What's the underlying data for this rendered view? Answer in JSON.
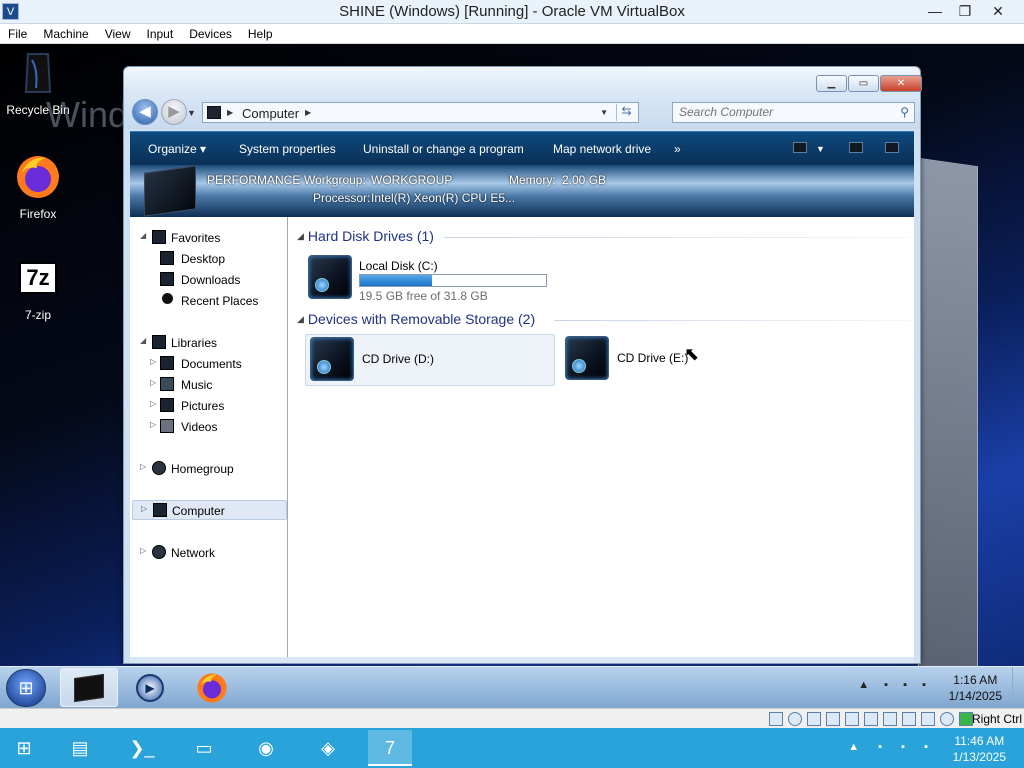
{
  "host_window": {
    "title": "SHINE (Windows) [Running] - Oracle VM VirtualBox",
    "menu": [
      "File",
      "Machine",
      "View",
      "Input",
      "Devices",
      "Help"
    ]
  },
  "desktop": {
    "watermark": "Wind",
    "icons": [
      {
        "label": "Recycle Bin",
        "icon": "recycle-bin-icon"
      },
      {
        "label": "Firefox",
        "icon": "firefox-icon"
      },
      {
        "label": "7-zip",
        "icon": "7zip-icon"
      }
    ]
  },
  "explorer": {
    "address": "Computer",
    "search_placeholder": "Search Computer",
    "commands": [
      "Organize ▾",
      "System properties",
      "Uninstall or change a program",
      "Map network drive",
      "»"
    ],
    "info": {
      "name": "PERFORMANCE",
      "workgroup_label": "Workgroup:",
      "workgroup": "WORKGROUP",
      "memory_label": "Memory:",
      "memory": "2.00 GB",
      "processor_label": "Processor:",
      "processor": "Intel(R) Xeon(R) CPU E5..."
    },
    "nav": {
      "favorites": "Favorites",
      "desktop": "Desktop",
      "downloads": "Downloads",
      "recent": "Recent Places",
      "libraries": "Libraries",
      "documents": "Documents",
      "music": "Music",
      "pictures": "Pictures",
      "videos": "Videos",
      "homegroup": "Homegroup",
      "computer": "Computer",
      "network": "Network"
    },
    "groups": {
      "hdd": "Hard Disk Drives (1)",
      "removable": "Devices with Removable Storage (2)"
    },
    "drives": {
      "c_name": "Local Disk (C:)",
      "c_free": "19.5 GB free of 31.8 GB",
      "c_used_fraction": 0.387,
      "d_name": "CD Drive (D:)",
      "e_name": "CD Drive (E:)"
    }
  },
  "guest_taskbar": {
    "time": "1:16 AM",
    "date": "1/14/2025"
  },
  "vbox_status": {
    "host_key": "Right Ctrl"
  },
  "host_taskbar": {
    "time": "11:46 AM",
    "date": "1/13/2025"
  }
}
